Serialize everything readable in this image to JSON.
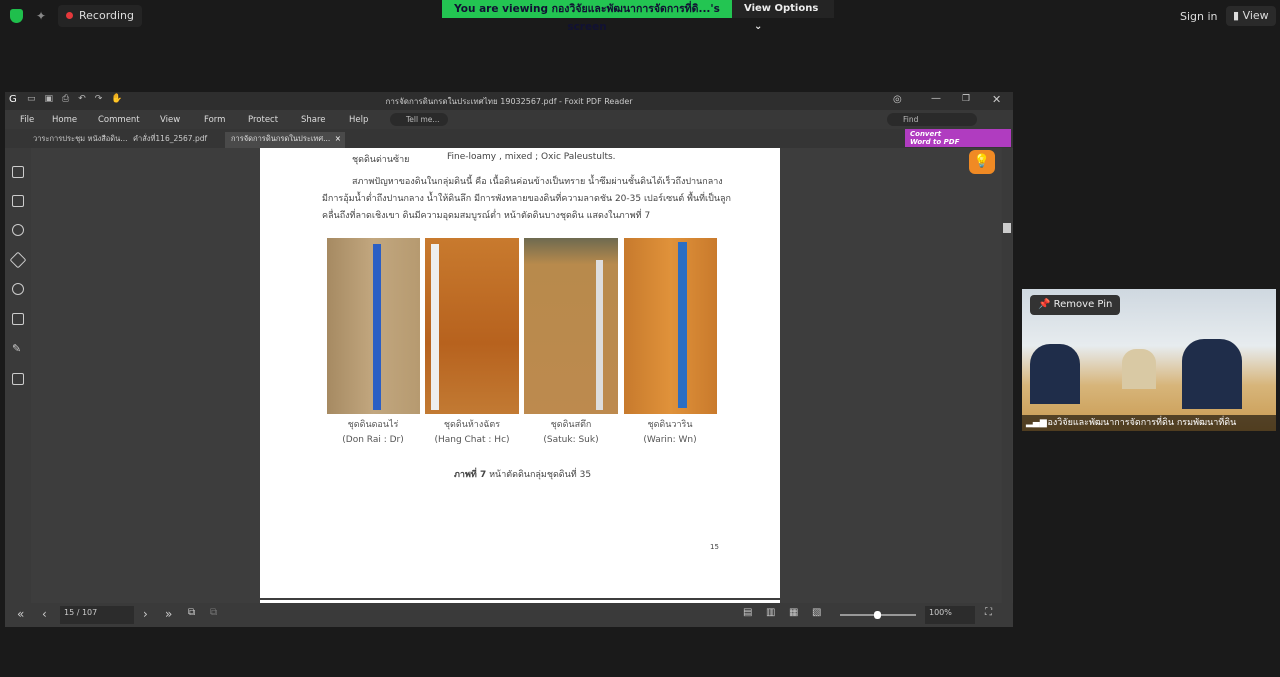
{
  "zoom": {
    "recording": "Recording",
    "banner": "You are viewing กองวิจัยและพัฒนาการจัดการที่ดิ...'s screen",
    "view_options": "View Options",
    "sign_in": "Sign in",
    "view": "View"
  },
  "window": {
    "title": "การจัดการดินกรดในประเทศไทย 19032567.pdf - Foxit PDF Reader",
    "menu": [
      "File",
      "Home",
      "Comment",
      "View",
      "Form",
      "Protect",
      "Share",
      "Help"
    ],
    "tell_me": "Tell me...",
    "find": "Find",
    "tabs": [
      "วาระการประชุม หนังสือดิน...",
      "คำสั่งที่116_2567.pdf",
      "การจัดการดินกรดในประเทศ..."
    ],
    "convert": {
      "line1": "Convert",
      "line2": "Word to PDF"
    }
  },
  "page": {
    "soil_line_label": "ชุดดินด่านซ้าย",
    "soil_line_value": "Fine-loamy , mixed ; Oxic Paleustults.",
    "para": [
      "สภาพปัญหาของดินในกลุ่มดินนี้ คือ เนื้อดินค่อนข้างเป็นทราย น้ำซึมผ่านชั้นดินได้เร็วถึงปานกลาง",
      "มีการอุ้มน้ำต่ำถึงปานกลาง น้ำให้ดินลึก มีการพังทลายของดินที่ความลาดชัน 20-35 เปอร์เซนต์ พื้นที่เป็นลูก",
      "คลื่นถึงที่ลาดเชิงเขา ดินมีความอุดมสมบูรณ์ต่ำ หน้าตัดดินบางชุดดิน แสดงในภาพที่ 7"
    ],
    "photos": [
      {
        "th": "ชุดดินดอนไร่",
        "en": "(Don Rai : Dr)",
        "tag": "Dr"
      },
      {
        "th": "ชุดดินห้างฉัตร",
        "en": "(Hang Chat : Hc)",
        "tag": "Hc"
      },
      {
        "th": "ชุดดินสตึก",
        "en": "(Satuk: Suk)",
        "tag": "Suk"
      },
      {
        "th": "ชุดดินวาริน",
        "en": "(Warin: Wn)",
        "tag": ""
      }
    ],
    "figure_bold": "ภาพที่ 7",
    "figure_text": "หน้าตัดดินกลุ่มชุดดินที่ 35",
    "page_number": "15"
  },
  "bottom": {
    "page": "15 / 107",
    "zoom": "100%"
  },
  "video": {
    "remove_pin": "Remove Pin",
    "name": "กองวิจัยและพัฒนาการจัดการที่ดิน กรมพัฒนาที่ดิน"
  }
}
